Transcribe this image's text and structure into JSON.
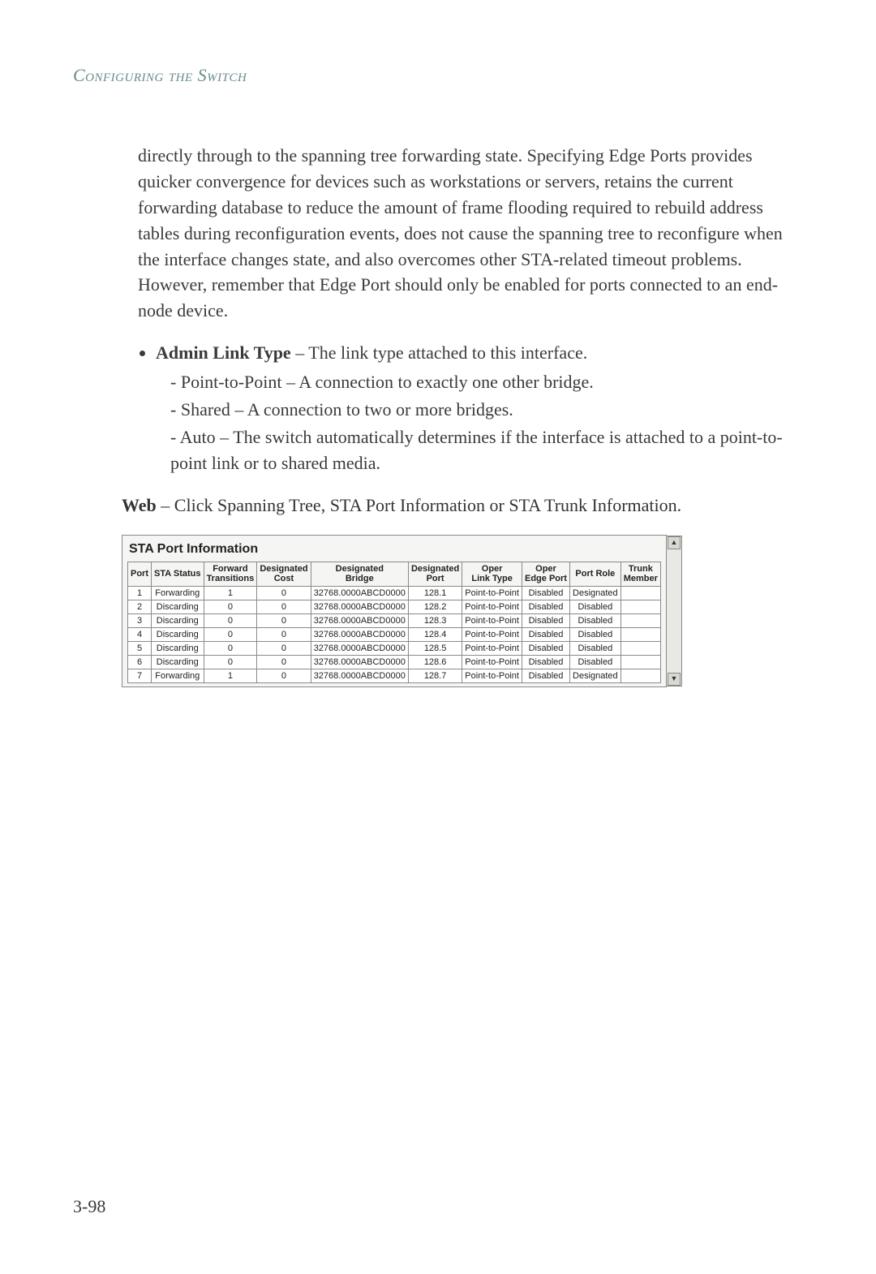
{
  "header": {
    "running_head": "Configuring the Switch"
  },
  "body": {
    "intro_paragraph": "directly through to the spanning tree forwarding state. Specifying Edge Ports provides quicker convergence for devices such as workstations or servers, retains the current forwarding database to reduce the amount of frame flooding required to rebuild address tables during reconfiguration events, does not cause the spanning tree to reconfigure when the interface changes state, and also overcomes other STA-related timeout problems. However, remember that Edge Port should only be enabled for ports connected to an end-node device.",
    "bullet_label": "Admin Link Type",
    "bullet_desc": " – The link type attached to this interface.",
    "subitems": [
      "Point-to-Point – A connection to exactly one other bridge.",
      "Shared – A connection to two or more bridges.",
      "Auto – The switch automatically determines if the interface is attached to a point-to-point link or to shared media."
    ],
    "web_label": "Web",
    "web_text": " – Click Spanning Tree, STA Port Information or STA Trunk Information."
  },
  "sta_table": {
    "title": "STA Port Information",
    "columns": [
      "Port",
      "STA Status",
      "Forward Transitions",
      "Designated Cost",
      "Designated Bridge",
      "Designated Port",
      "Oper Link Type",
      "Oper Edge Port",
      "Port Role",
      "Trunk Member"
    ],
    "rows": [
      {
        "port": "1",
        "status": "Forwarding",
        "ft": "1",
        "dc": "0",
        "db": "32768.0000ABCD0000",
        "dp": "128.1",
        "olt": "Point-to-Point",
        "oep": "Disabled",
        "role": "Designated",
        "trunk": ""
      },
      {
        "port": "2",
        "status": "Discarding",
        "ft": "0",
        "dc": "0",
        "db": "32768.0000ABCD0000",
        "dp": "128.2",
        "olt": "Point-to-Point",
        "oep": "Disabled",
        "role": "Disabled",
        "trunk": ""
      },
      {
        "port": "3",
        "status": "Discarding",
        "ft": "0",
        "dc": "0",
        "db": "32768.0000ABCD0000",
        "dp": "128.3",
        "olt": "Point-to-Point",
        "oep": "Disabled",
        "role": "Disabled",
        "trunk": ""
      },
      {
        "port": "4",
        "status": "Discarding",
        "ft": "0",
        "dc": "0",
        "db": "32768.0000ABCD0000",
        "dp": "128.4",
        "olt": "Point-to-Point",
        "oep": "Disabled",
        "role": "Disabled",
        "trunk": ""
      },
      {
        "port": "5",
        "status": "Discarding",
        "ft": "0",
        "dc": "0",
        "db": "32768.0000ABCD0000",
        "dp": "128.5",
        "olt": "Point-to-Point",
        "oep": "Disabled",
        "role": "Disabled",
        "trunk": ""
      },
      {
        "port": "6",
        "status": "Discarding",
        "ft": "0",
        "dc": "0",
        "db": "32768.0000ABCD0000",
        "dp": "128.6",
        "olt": "Point-to-Point",
        "oep": "Disabled",
        "role": "Disabled",
        "trunk": ""
      },
      {
        "port": "7",
        "status": "Forwarding",
        "ft": "1",
        "dc": "0",
        "db": "32768.0000ABCD0000",
        "dp": "128.7",
        "olt": "Point-to-Point",
        "oep": "Disabled",
        "role": "Designated",
        "trunk": ""
      }
    ]
  },
  "footer": {
    "page_number": "3-98"
  }
}
